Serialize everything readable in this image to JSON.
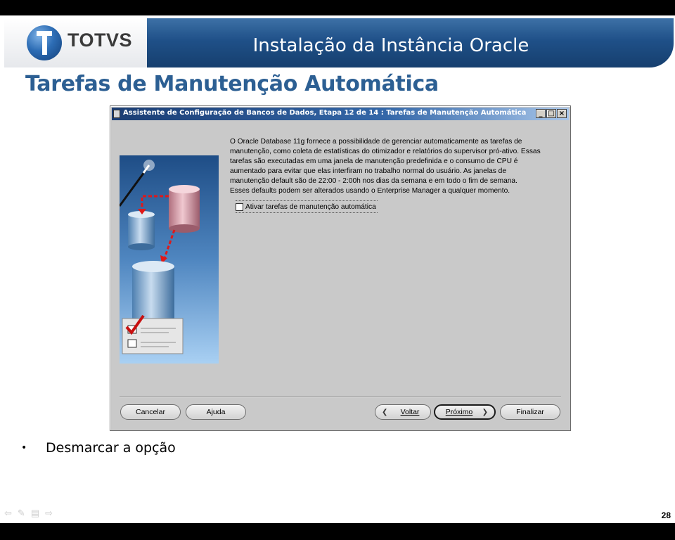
{
  "header": {
    "logo_text": "TOTVS",
    "title": "Instalação  da Instância Oracle"
  },
  "page_title": "Tarefas de Manutenção Automática",
  "dialog": {
    "title": "Assistente de Configuração de Bancos de Dados, Etapa 12 de 14 : Tarefas de Manutenção Automática",
    "window_buttons": {
      "minimize": "_",
      "maximize": "□",
      "close": "×"
    },
    "description": [
      "O Oracle Database 11g fornece a possibilidade de gerenciar automaticamente as tarefas de",
      "manutenção, como coleta de estatísticas do otimizador e relatórios do supervisor pró-ativo. Essas",
      "tarefas são executadas em uma janela de manutenção predefinida e o consumo de CPU é",
      "aumentado para evitar que elas interfiram no trabalho normal do usuário. As janelas de",
      "manutenção default são de 22:00 - 2:00h nos dias da semana e em todo o fim de semana.",
      "Esses defaults podem ser alterados usando o Enterprise Manager a qualquer momento."
    ],
    "checkbox": {
      "label": "Ativar tarefas de manutenção automática",
      "checked": false
    },
    "buttons": {
      "cancel": "Cancelar",
      "help": "Ajuda",
      "back": "Voltar",
      "next": "Próximo",
      "finish": "Finalizar"
    }
  },
  "bullet": "Desmarcar a opção",
  "slide_number": "28",
  "colors": {
    "header_bar": "#1f5088",
    "page_title": "#2c5f93",
    "dialog_bg": "#c9c9c9"
  }
}
